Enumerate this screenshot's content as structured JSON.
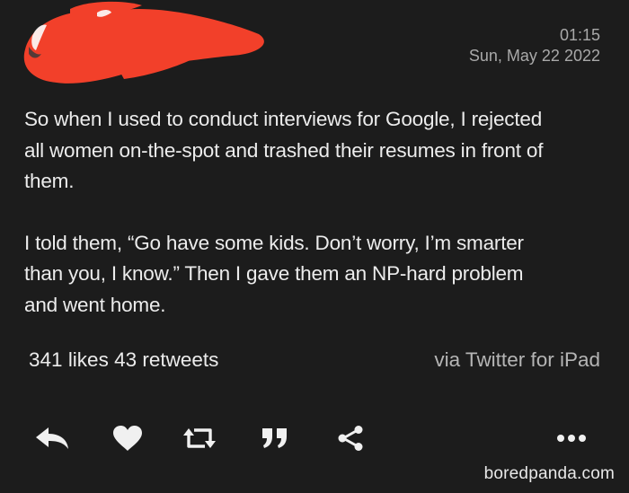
{
  "tweet": {
    "time": "01:15",
    "date": "Sun, May 22 2022",
    "paragraphs": [
      "So when I used to conduct interviews for Google, I rejected\nall women on-the-spot and trashed their resumes in front of\nthem.",
      "I told them, “Go have some kids.  Don’t worry, I’m smarter\nthan you, I know.”  Then I gave them an NP-hard problem\nand went home."
    ],
    "likes_count": "341",
    "likes_label": "likes",
    "retweets_count": "43",
    "retweets_label": "retweets",
    "via": "via Twitter for iPad"
  },
  "actions": [
    {
      "name": "reply-icon"
    },
    {
      "name": "heart-icon"
    },
    {
      "name": "retweet-icon"
    },
    {
      "name": "quote-icon"
    },
    {
      "name": "share-icon"
    },
    {
      "name": "more-icon"
    }
  ],
  "watermark": "boredpanda.com",
  "colors": {
    "background": "#1c1c1c",
    "text": "#ececec",
    "muted": "#a9a9a9",
    "redaction": "#f2402a"
  }
}
